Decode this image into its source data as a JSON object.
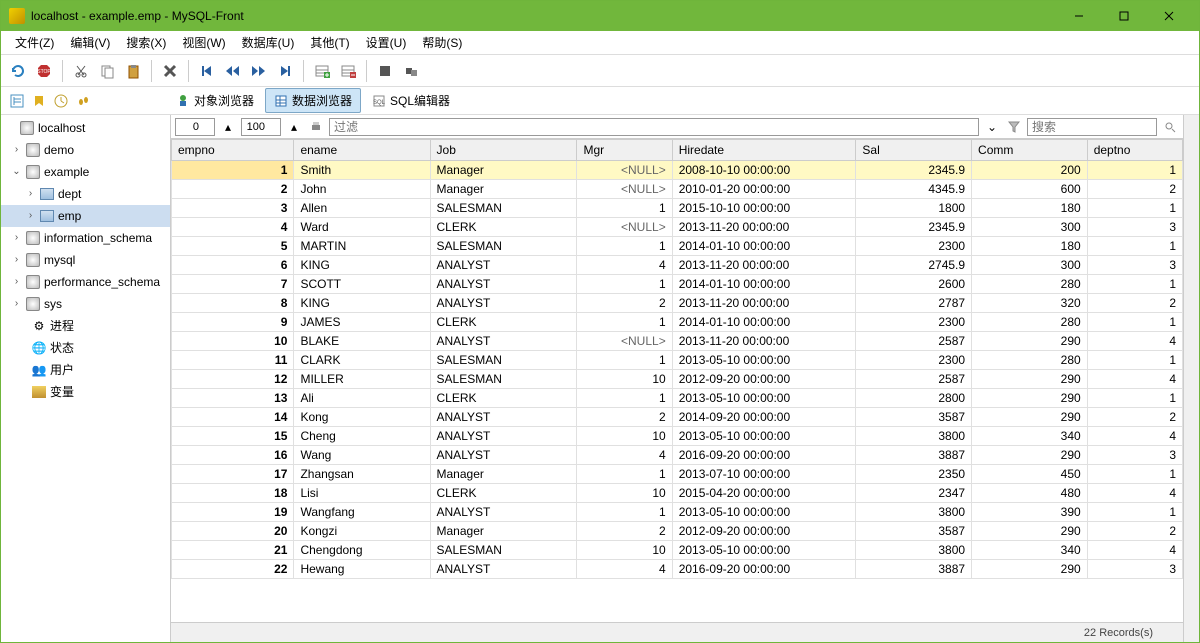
{
  "window": {
    "title": "localhost - example.emp - MySQL-Front"
  },
  "menu": {
    "file": "文件(Z)",
    "edit": "编辑(V)",
    "search": "搜索(X)",
    "view": "视图(W)",
    "database": "数据库(U)",
    "other": "其他(T)",
    "settings": "设置(U)",
    "help": "帮助(S)"
  },
  "viewtabs": {
    "object": "对象浏览器",
    "data": "数据浏览器",
    "sql": "SQL编辑器"
  },
  "sidebar": {
    "host": "localhost",
    "db_demo": "demo",
    "db_example": "example",
    "tbl_dept": "dept",
    "tbl_emp": "emp",
    "db_infoschema": "information_schema",
    "db_mysql": "mysql",
    "db_perfschema": "performance_schema",
    "db_sys": "sys",
    "process": "进程",
    "status": "状态",
    "users": "用户",
    "variables": "变量"
  },
  "filter": {
    "offset": "0",
    "limit": "100",
    "filter_placeholder": "过滤",
    "search_placeholder": "搜索"
  },
  "columns": [
    "empno",
    "ename",
    "Job",
    "Mgr",
    "Hiredate",
    "Sal",
    "Comm",
    "deptno"
  ],
  "rows": [
    {
      "empno": 1,
      "ename": "Smith",
      "job": "Manager",
      "mgr": "<NULL>",
      "hiredate": "2008-10-10 00:00:00",
      "sal": "2345.9",
      "comm": "200",
      "deptno": 1,
      "sel": true
    },
    {
      "empno": 2,
      "ename": "John",
      "job": "Manager",
      "mgr": "<NULL>",
      "hiredate": "2010-01-20 00:00:00",
      "sal": "4345.9",
      "comm": "600",
      "deptno": 2
    },
    {
      "empno": 3,
      "ename": "Allen",
      "job": "SALESMAN",
      "mgr": "1",
      "hiredate": "2015-10-10 00:00:00",
      "sal": "1800",
      "comm": "180",
      "deptno": 1
    },
    {
      "empno": 4,
      "ename": "Ward",
      "job": "CLERK",
      "mgr": "<NULL>",
      "hiredate": "2013-11-20 00:00:00",
      "sal": "2345.9",
      "comm": "300",
      "deptno": 3
    },
    {
      "empno": 5,
      "ename": "MARTIN",
      "job": "SALESMAN",
      "mgr": "1",
      "hiredate": "2014-01-10 00:00:00",
      "sal": "2300",
      "comm": "180",
      "deptno": 1
    },
    {
      "empno": 6,
      "ename": "KING",
      "job": "ANALYST",
      "mgr": "4",
      "hiredate": "2013-11-20 00:00:00",
      "sal": "2745.9",
      "comm": "300",
      "deptno": 3
    },
    {
      "empno": 7,
      "ename": "SCOTT",
      "job": "ANALYST",
      "mgr": "1",
      "hiredate": "2014-01-10 00:00:00",
      "sal": "2600",
      "comm": "280",
      "deptno": 1
    },
    {
      "empno": 8,
      "ename": "KING",
      "job": "ANALYST",
      "mgr": "2",
      "hiredate": "2013-11-20 00:00:00",
      "sal": "2787",
      "comm": "320",
      "deptno": 2
    },
    {
      "empno": 9,
      "ename": "JAMES",
      "job": "CLERK",
      "mgr": "1",
      "hiredate": "2014-01-10 00:00:00",
      "sal": "2300",
      "comm": "280",
      "deptno": 1
    },
    {
      "empno": 10,
      "ename": "BLAKE",
      "job": "ANALYST",
      "mgr": "<NULL>",
      "hiredate": "2013-11-20 00:00:00",
      "sal": "2587",
      "comm": "290",
      "deptno": 4
    },
    {
      "empno": 11,
      "ename": "CLARK",
      "job": "SALESMAN",
      "mgr": "1",
      "hiredate": "2013-05-10 00:00:00",
      "sal": "2300",
      "comm": "280",
      "deptno": 1
    },
    {
      "empno": 12,
      "ename": "MILLER",
      "job": "SALESMAN",
      "mgr": "10",
      "hiredate": "2012-09-20 00:00:00",
      "sal": "2587",
      "comm": "290",
      "deptno": 4
    },
    {
      "empno": 13,
      "ename": "Ali",
      "job": "CLERK",
      "mgr": "1",
      "hiredate": "2013-05-10 00:00:00",
      "sal": "2800",
      "comm": "290",
      "deptno": 1
    },
    {
      "empno": 14,
      "ename": "Kong",
      "job": "ANALYST",
      "mgr": "2",
      "hiredate": "2014-09-20 00:00:00",
      "sal": "3587",
      "comm": "290",
      "deptno": 2
    },
    {
      "empno": 15,
      "ename": "Cheng",
      "job": "ANALYST",
      "mgr": "10",
      "hiredate": "2013-05-10 00:00:00",
      "sal": "3800",
      "comm": "340",
      "deptno": 4
    },
    {
      "empno": 16,
      "ename": "Wang",
      "job": "ANALYST",
      "mgr": "4",
      "hiredate": "2016-09-20 00:00:00",
      "sal": "3887",
      "comm": "290",
      "deptno": 3
    },
    {
      "empno": 17,
      "ename": "Zhangsan",
      "job": "Manager",
      "mgr": "1",
      "hiredate": "2013-07-10 00:00:00",
      "sal": "2350",
      "comm": "450",
      "deptno": 1
    },
    {
      "empno": 18,
      "ename": "Lisi",
      "job": "CLERK",
      "mgr": "10",
      "hiredate": "2015-04-20 00:00:00",
      "sal": "2347",
      "comm": "480",
      "deptno": 4
    },
    {
      "empno": 19,
      "ename": "Wangfang",
      "job": "ANALYST",
      "mgr": "1",
      "hiredate": "2013-05-10 00:00:00",
      "sal": "3800",
      "comm": "390",
      "deptno": 1
    },
    {
      "empno": 20,
      "ename": "Kongzi",
      "job": "Manager",
      "mgr": "2",
      "hiredate": "2012-09-20 00:00:00",
      "sal": "3587",
      "comm": "290",
      "deptno": 2
    },
    {
      "empno": 21,
      "ename": "Chengdong",
      "job": "SALESMAN",
      "mgr": "10",
      "hiredate": "2013-05-10 00:00:00",
      "sal": "3800",
      "comm": "340",
      "deptno": 4
    },
    {
      "empno": 22,
      "ename": "Hewang",
      "job": "ANALYST",
      "mgr": "4",
      "hiredate": "2016-09-20 00:00:00",
      "sal": "3887",
      "comm": "290",
      "deptno": 3
    }
  ],
  "status": {
    "records": "22 Records(s)"
  }
}
